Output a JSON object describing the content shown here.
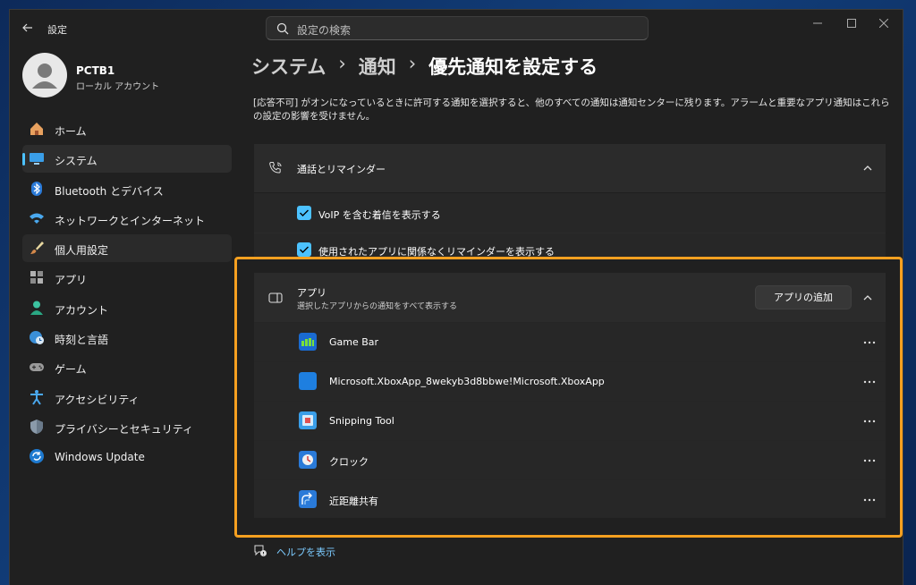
{
  "window": {
    "title": "設定",
    "search_placeholder": "設定の検索"
  },
  "profile": {
    "name": "PCTB1",
    "account_type": "ローカル アカウント"
  },
  "sidebar": {
    "items": [
      {
        "label": "ホーム",
        "icon": "home-icon"
      },
      {
        "label": "システム",
        "icon": "system-icon"
      },
      {
        "label": "Bluetooth とデバイス",
        "icon": "bluetooth-icon"
      },
      {
        "label": "ネットワークとインターネット",
        "icon": "network-icon"
      },
      {
        "label": "個人用設定",
        "icon": "brush-icon"
      },
      {
        "label": "アプリ",
        "icon": "apps-icon"
      },
      {
        "label": "アカウント",
        "icon": "account-icon"
      },
      {
        "label": "時刻と言語",
        "icon": "globe-clock-icon"
      },
      {
        "label": "ゲーム",
        "icon": "gamepad-icon"
      },
      {
        "label": "アクセシビリティ",
        "icon": "accessibility-icon"
      },
      {
        "label": "プライバシーとセキュリティ",
        "icon": "shield-icon"
      },
      {
        "label": "Windows Update",
        "icon": "update-icon"
      }
    ],
    "active_index": 1
  },
  "breadcrumb": {
    "level1": "システム",
    "level2": "通知",
    "current": "優先通知を設定する",
    "separator": "›"
  },
  "description": "[応答不可] がオンになっているときに許可する通知を選択すると、他のすべての通知は通知センターに残ります。アラームと重要なアプリ通知はこれらの設定の影響を受けません。",
  "calls_section": {
    "title": "通話とリマインダー",
    "options": [
      {
        "label": "VoIP を含む着信を表示する",
        "checked": true
      },
      {
        "label": "使用されたアプリに関係なくリマインダーを表示する",
        "checked": true
      }
    ]
  },
  "apps_section": {
    "title": "アプリ",
    "subtitle": "選択したアプリからの通知をすべて表示する",
    "add_button": "アプリの追加",
    "apps": [
      {
        "name": "Game Bar",
        "icon": "game-bar-icon"
      },
      {
        "name": "Microsoft.XboxApp_8wekyb3d8bbwe!Microsoft.XboxApp",
        "icon": "xbox-app-icon"
      },
      {
        "name": "Snipping Tool",
        "icon": "snipping-tool-icon"
      },
      {
        "name": "クロック",
        "icon": "clock-icon"
      },
      {
        "name": "近距離共有",
        "icon": "nearby-share-icon"
      }
    ]
  },
  "help_link": "ヘルプを表示",
  "colors": {
    "accent": "#4cc2ff",
    "highlight": "#f5a020",
    "background": "#202020",
    "card": "#2b2b2b"
  }
}
